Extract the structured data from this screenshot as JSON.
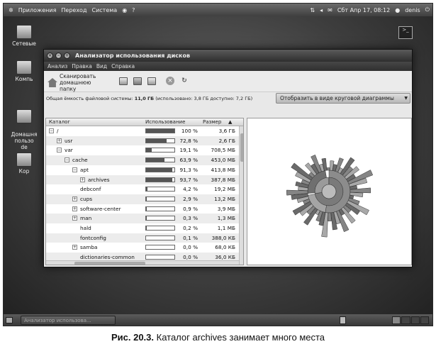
{
  "top_panel": {
    "menus": [
      "Приложения",
      "Переход",
      "Система"
    ],
    "clock": "Сбт Апр 17, 08:12",
    "user": "denis"
  },
  "desktop_icons": [
    {
      "label": "Сетевые"
    },
    {
      "label": "Компь"
    },
    {
      "label": "Домашня\nпользо\nde"
    },
    {
      "label": "Кор"
    }
  ],
  "window": {
    "title": "Анализатор использования дисков",
    "menu": [
      "Анализ",
      "Правка",
      "Вид",
      "Справка"
    ],
    "toolbar": {
      "scan_home_label": "Сканировать домашнюю папку"
    },
    "info": {
      "capacity_label": "Общая ёмкость файловой системы:",
      "capacity_value": "11,0 ГБ",
      "rest": "(использовано: 3,8 ГБ доступно: 7,2 ГБ)"
    },
    "view_combo": "Отобразить в виде круговой диаграммы",
    "columns": {
      "folder": "Каталог",
      "usage": "Использование",
      "size": "Размер"
    },
    "rows": [
      {
        "name": "/",
        "pct_value": 100,
        "pct": "100 %",
        "size": "3,6 ГБ",
        "depth": 0,
        "expander": "−"
      },
      {
        "name": "usr",
        "pct_value": 72.8,
        "pct": "72,8 %",
        "size": "2,6 ГБ",
        "depth": 1,
        "expander": "+"
      },
      {
        "name": "var",
        "pct_value": 19.1,
        "pct": "19,1 %",
        "size": "708,5 МБ",
        "depth": 1,
        "expander": "−"
      },
      {
        "name": "cache",
        "pct_value": 63.9,
        "pct": "63,9 %",
        "size": "453,0 МБ",
        "depth": 2,
        "expander": "−"
      },
      {
        "name": "apt",
        "pct_value": 91.3,
        "pct": "91,3 %",
        "size": "413,8 МБ",
        "depth": 3,
        "expander": "−"
      },
      {
        "name": "archives",
        "pct_value": 93.7,
        "pct": "93,7 %",
        "size": "387,8 МБ",
        "depth": 4,
        "expander": "+"
      },
      {
        "name": "debconf",
        "pct_value": 4.2,
        "pct": "4,2 %",
        "size": "19,2 МБ",
        "depth": 3,
        "expander": ""
      },
      {
        "name": "cups",
        "pct_value": 2.9,
        "pct": "2,9 %",
        "size": "13,2 МБ",
        "depth": 3,
        "expander": "+"
      },
      {
        "name": "software-center",
        "pct_value": 0.9,
        "pct": "0,9 %",
        "size": "3,9 МБ",
        "depth": 3,
        "expander": "+"
      },
      {
        "name": "man",
        "pct_value": 0.3,
        "pct": "0,3 %",
        "size": "1,3 МБ",
        "depth": 3,
        "expander": "+"
      },
      {
        "name": "hald",
        "pct_value": 0.2,
        "pct": "0,2 %",
        "size": "1,1 МБ",
        "depth": 3,
        "expander": ""
      },
      {
        "name": "fontconfig",
        "pct_value": 0.1,
        "pct": "0,1 %",
        "size": "388,0 КБ",
        "depth": 3,
        "expander": ""
      },
      {
        "name": "samba",
        "pct_value": 0.0,
        "pct": "0,0 %",
        "size": "68,0 КБ",
        "depth": 3,
        "expander": "+"
      },
      {
        "name": "dictionaries-common",
        "pct_value": 0.0,
        "pct": "0,0 %",
        "size": "36,0 КБ",
        "depth": 3,
        "expander": ""
      }
    ]
  },
  "taskbar": {
    "task_label": "Анализатор использова..."
  },
  "caption": {
    "prefix": "Рис. 20.3.",
    "text": "Каталог archives занимает много места"
  },
  "colors": {
    "panel": "#3f3f3f",
    "bar_fill": "#555555",
    "ring_fill": "#8a8a8a"
  }
}
